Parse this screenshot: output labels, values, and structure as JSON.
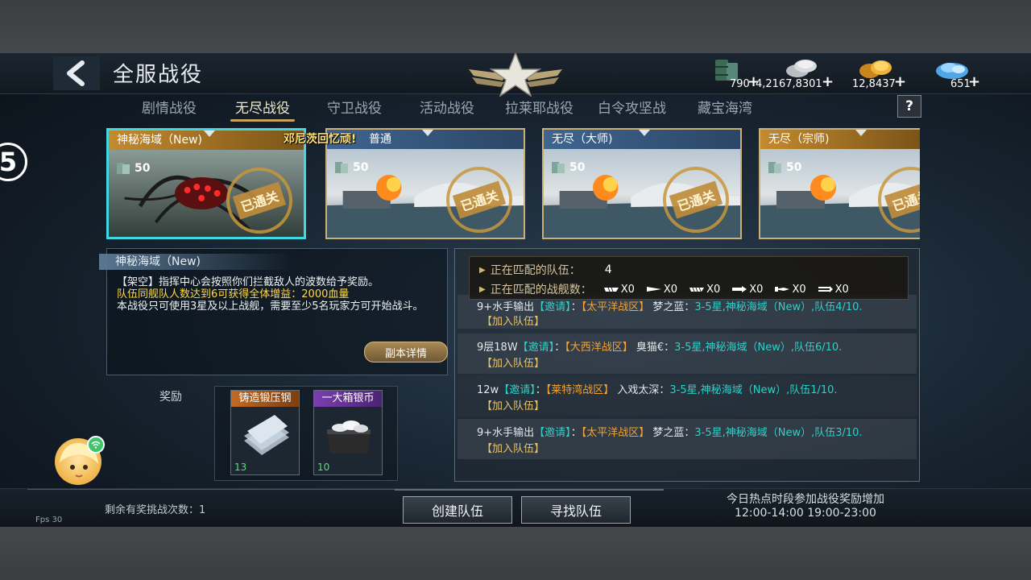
{
  "header": {
    "title": "全服战役"
  },
  "resources": [
    {
      "icon": "fuel-barrel-icon",
      "value": "790"
    },
    {
      "icon": "silver-coins-icon",
      "value": "4,2167,8301"
    },
    {
      "icon": "gold-coins-icon",
      "value": "12,8437"
    },
    {
      "icon": "diamond-icon",
      "value": "651"
    }
  ],
  "tabs": [
    "剧情战役",
    "无尽战役",
    "守卫战役",
    "活动战役",
    "拉莱耶战役",
    "白令攻坚战",
    "藏宝海湾"
  ],
  "active_tab": "无尽战役",
  "help_label": "?",
  "side_badge": "5",
  "scroll_message": "邓尼茨回忆顽!",
  "cards": [
    {
      "label": "神秘海域（New)",
      "cost": "50",
      "stamp": "已通关",
      "color": "#c48a2e"
    },
    {
      "label": "普通",
      "cost": "50",
      "stamp": "已通关",
      "color": "#4e78a8"
    },
    {
      "label": "无尽（大师)",
      "cost": "50",
      "stamp": "已通关",
      "color": "#4e78a8"
    },
    {
      "label": "无尽（宗师)",
      "cost": "50",
      "stamp": "已通关",
      "color": "#c48a2e"
    }
  ],
  "description": {
    "title": "神秘海域（New)",
    "line1": "【架空】指挥中心会按照你们拦截敌人的波数给予奖励。",
    "line2": "队伍同舰队人数达到6可获得全体增益：2000血量",
    "line3": "本战役只可使用3星及以上战舰，需要至少5名玩家方可开始战斗。",
    "detail_button": "副本详情"
  },
  "rewards": {
    "label": "奖励",
    "items": [
      {
        "name": "铸造锻压钢",
        "count": "13"
      },
      {
        "name": "一大箱银币",
        "count": "10"
      }
    ]
  },
  "matching": {
    "teams_label": "正在匹配的队伍：",
    "teams_value": "4",
    "ships_label": "正在匹配的战舰数：",
    "ship_counts": [
      "X0",
      "X0",
      "X0",
      "X0",
      "X0",
      "X0"
    ]
  },
  "teams": [
    {
      "prefix": "9+水手输出",
      "invite": "【邀请】",
      "sep": "：",
      "zone": "【太平洋战区】",
      "leader": "梦之蓝：",
      "info": "3-5星,神秘海域（New）,队伍4/10.",
      "join": "【加入队伍】"
    },
    {
      "prefix": "9层18W",
      "invite": "【邀请】",
      "sep": "：",
      "zone": "【大西洋战区】",
      "leader": "臭猫€：",
      "info": "3-5星,神秘海域（New）,队伍6/10.",
      "join": "【加入队伍】"
    },
    {
      "prefix": "12w",
      "invite": "【邀请】",
      "sep": "：",
      "zone": "【莱特湾战区】",
      "leader": "入戏太深：",
      "info": "3-5星,神秘海域（New）,队伍1/10.",
      "join": "【加入队伍】"
    },
    {
      "prefix": "9+水手输出",
      "invite": "【邀请】",
      "sep": "：",
      "zone": "【太平洋战区】",
      "leader": "梦之蓝：",
      "info": "3-5星,神秘海域（New）,队伍3/10.",
      "join": "【加入队伍】"
    }
  ],
  "footer": {
    "attempts": "剩余有奖挑战次数：1",
    "fps": "Fps 30",
    "create_team": "创建队伍",
    "find_team": "寻找队伍",
    "hot_line1": "今日热点时段参加战役奖励增加",
    "hot_line2": "12:00-14:00 19:00-23:00"
  }
}
